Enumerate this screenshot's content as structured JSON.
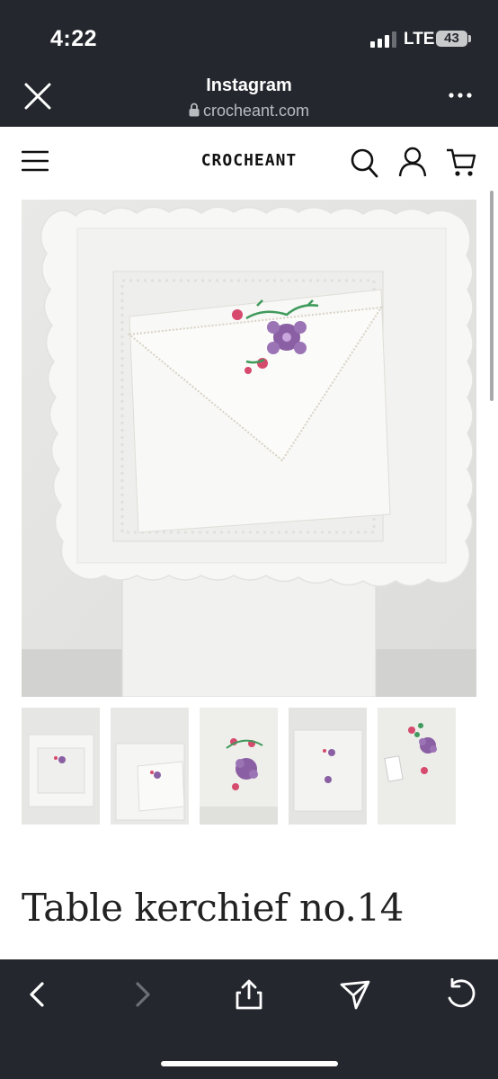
{
  "status_bar": {
    "time": "4:22",
    "network": "LTE",
    "battery": "43"
  },
  "browser_header": {
    "title": "Instagram",
    "url": "crocheant.com",
    "close_icon": "close-icon",
    "more_icon": "more-icon"
  },
  "site_header": {
    "logo": "CROCHEANT",
    "icons": [
      "menu-icon",
      "search-icon",
      "account-icon",
      "cart-icon"
    ]
  },
  "product": {
    "title": "Table kerchief no.14",
    "thumbnail_count": 5
  },
  "toolbar": {
    "icons": [
      "back-icon",
      "forward-icon",
      "share-icon",
      "send-icon",
      "reload-icon"
    ],
    "forward_enabled": false
  },
  "colors": {
    "chrome": "#24272d",
    "embroidery_purple": "#8a5fa3",
    "embroidery_pink": "#d64a6e",
    "embroidery_green": "#3f9a5c"
  }
}
